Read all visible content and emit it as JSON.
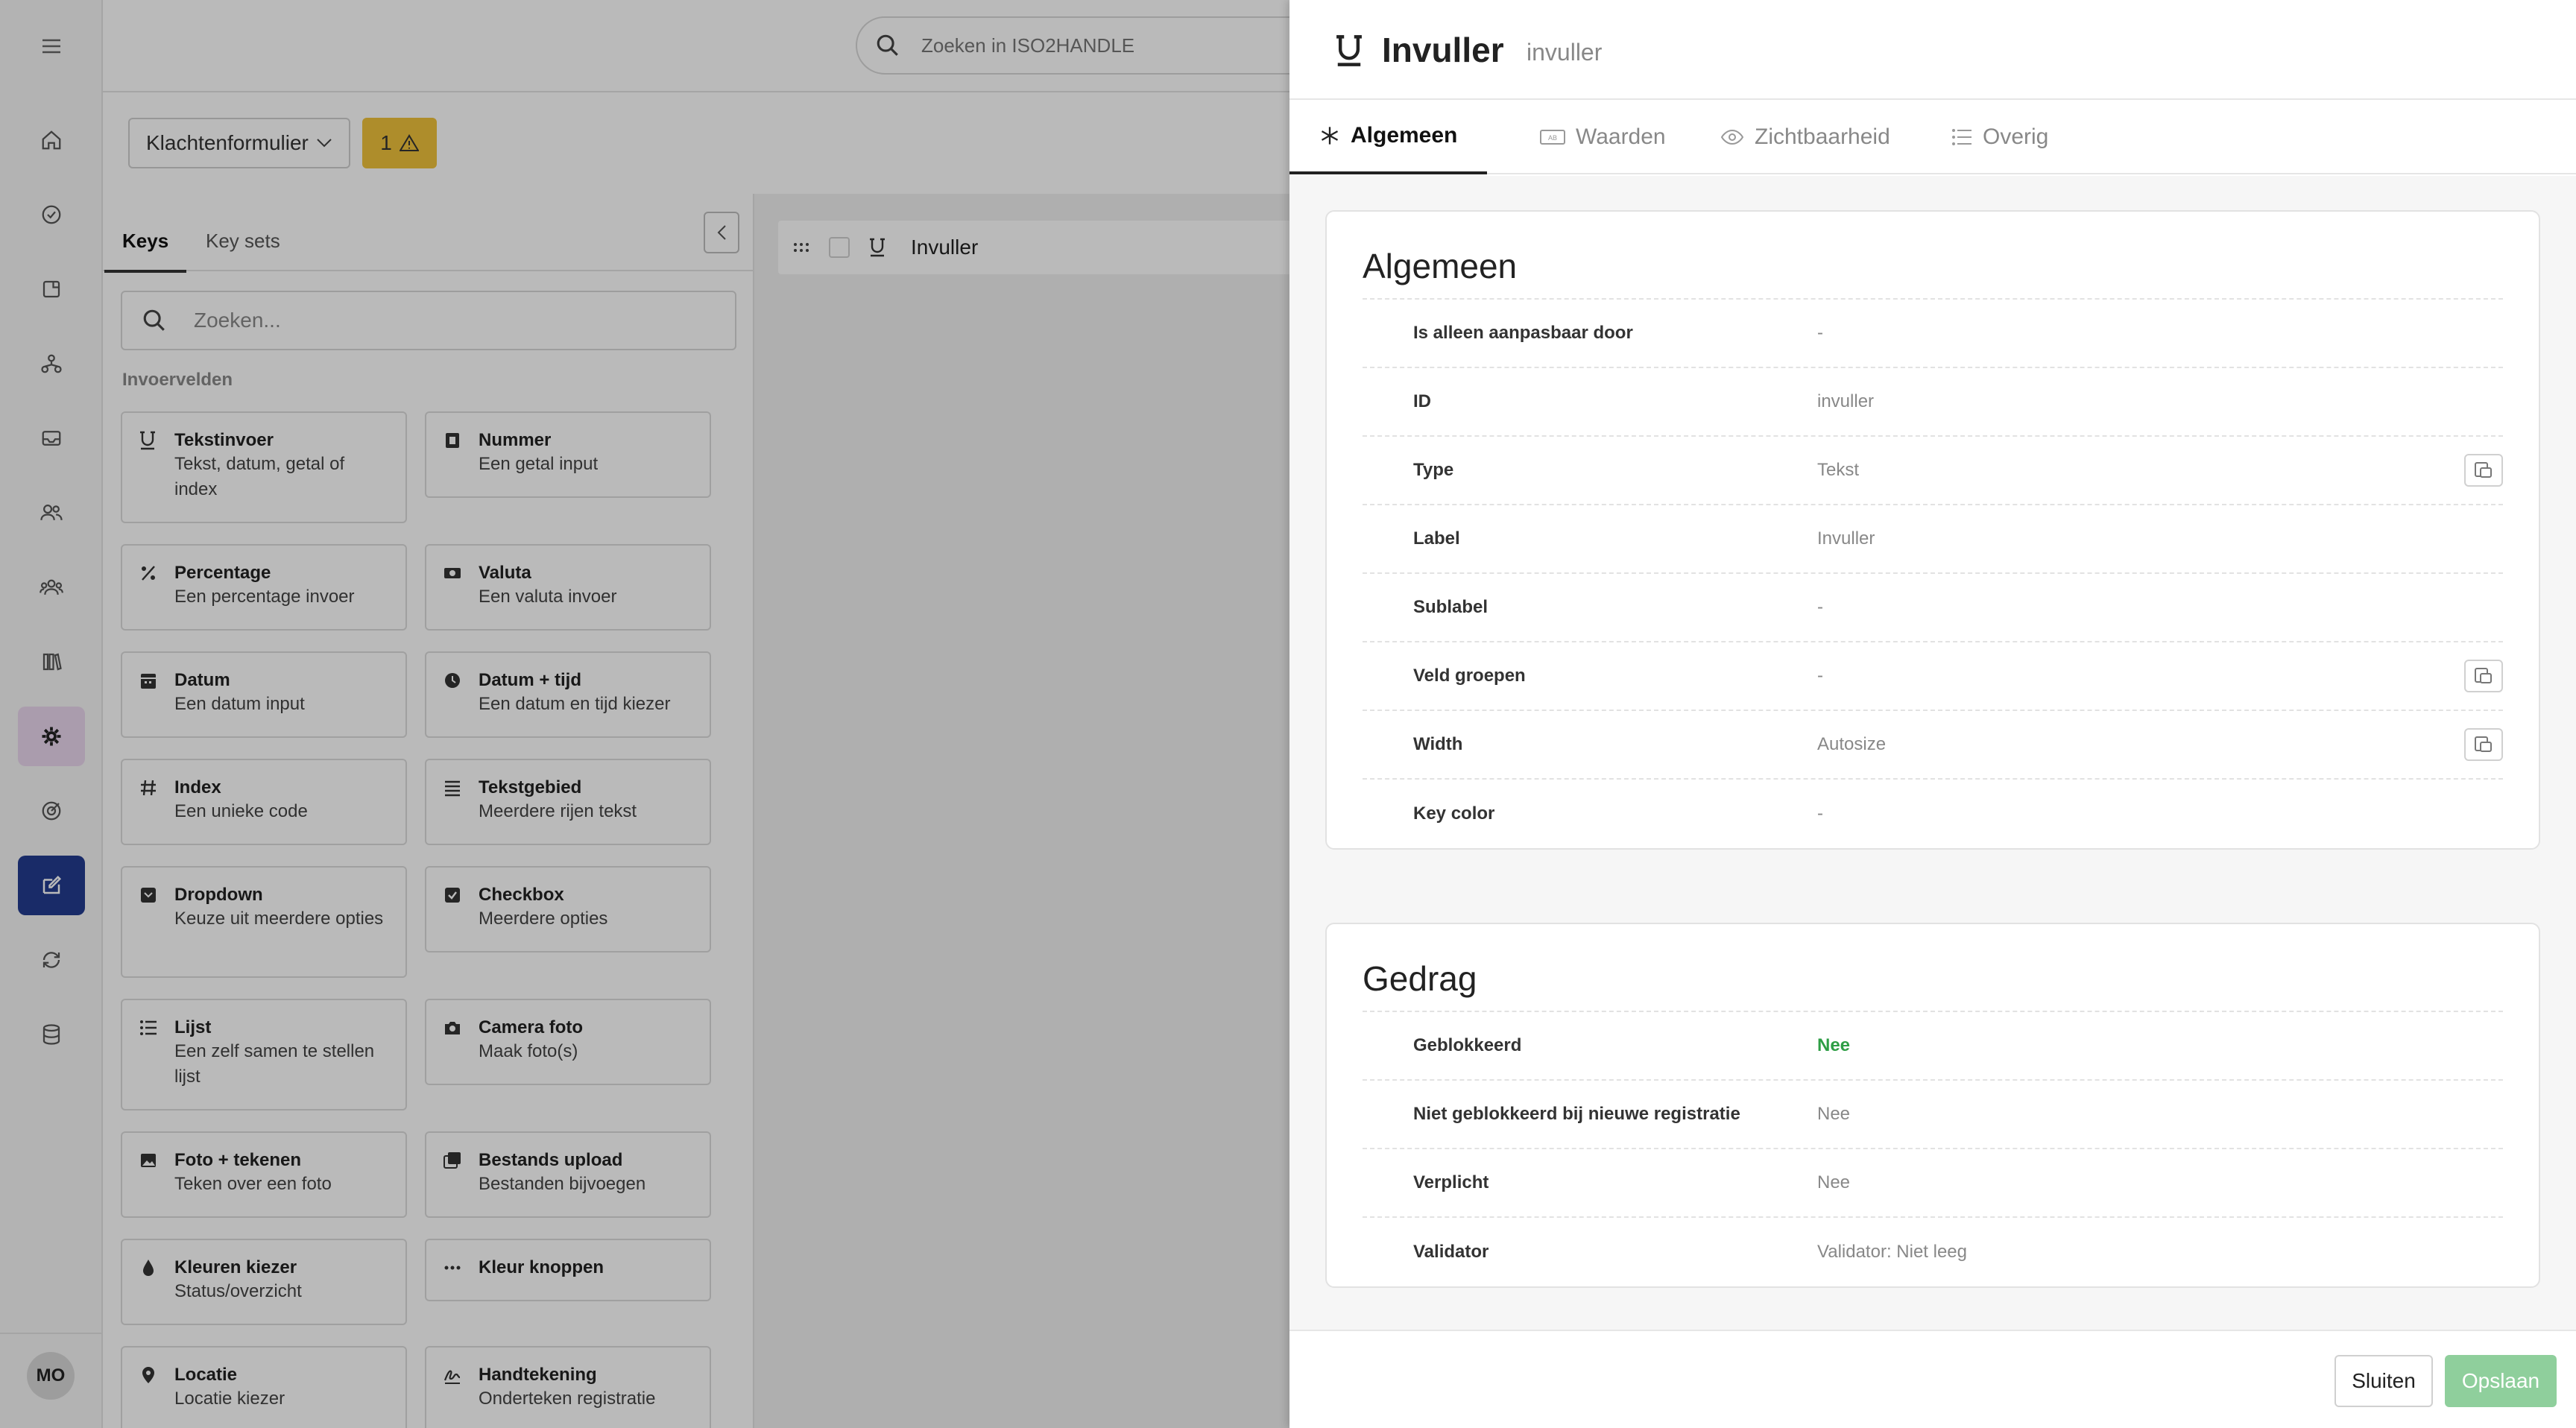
{
  "topbar": {
    "search_placeholder": "Zoeken in ISO2HANDLE"
  },
  "rail": {
    "items": [
      "home-icon",
      "check-circle-icon",
      "folder-icon",
      "hierarchy-icon",
      "inbox-icon",
      "users-icon",
      "group-icon",
      "books-icon",
      "gear-icon",
      "target-icon",
      "edit-form-icon",
      "sync-icon",
      "database-icon"
    ],
    "avatar_initials": "MO"
  },
  "form_selector": {
    "value": "Klachtenformulier",
    "warning_count": "1"
  },
  "keys_panel": {
    "tabs": [
      {
        "label": "Keys"
      },
      {
        "label": "Key sets"
      }
    ],
    "search_placeholder": "Zoeken...",
    "section_label": "Invoervelden",
    "cards": [
      {
        "title": "Tekstinvoer",
        "desc": "Tekst, datum, getal of index",
        "icon": "text-input-icon"
      },
      {
        "title": "Nummer",
        "desc": "Een getal input",
        "icon": "number-icon"
      },
      {
        "title": "Percentage",
        "desc": "Een percentage invoer",
        "icon": "percent-icon"
      },
      {
        "title": "Valuta",
        "desc": "Een valuta invoer",
        "icon": "currency-icon"
      },
      {
        "title": "Datum",
        "desc": "Een datum input",
        "icon": "calendar-icon"
      },
      {
        "title": "Datum + tijd",
        "desc": "Een datum en tijd kiezer",
        "icon": "clock-icon"
      },
      {
        "title": "Index",
        "desc": "Een unieke code",
        "icon": "hash-icon"
      },
      {
        "title": "Tekstgebied",
        "desc": "Meerdere rijen tekst",
        "icon": "lines-icon"
      },
      {
        "title": "Dropdown",
        "desc": "Keuze uit meerdere opties",
        "icon": "dropdown-icon"
      },
      {
        "title": "Checkbox",
        "desc": "Meerdere opties",
        "icon": "checkbox-icon"
      },
      {
        "title": "Lijst",
        "desc": "Een zelf samen te stellen lijst",
        "icon": "list-icon"
      },
      {
        "title": "Camera foto",
        "desc": "Maak foto(s)",
        "icon": "camera-icon"
      },
      {
        "title": "Foto + tekenen",
        "desc": "Teken over een foto",
        "icon": "image-icon"
      },
      {
        "title": "Bestands upload",
        "desc": "Bestanden bijvoegen",
        "icon": "upload-icon"
      },
      {
        "title": "Kleuren kiezer",
        "desc": "Status/overzicht",
        "icon": "droplet-icon"
      },
      {
        "title": "Kleur knoppen",
        "desc": "",
        "icon": "dots-icon"
      },
      {
        "title": "Locatie",
        "desc": "Locatie kiezer",
        "icon": "location-icon"
      },
      {
        "title": "Handtekening",
        "desc": "Onderteken registratie",
        "icon": "signature-icon"
      }
    ]
  },
  "canvas": {
    "row_label": "Invuller"
  },
  "drawer": {
    "title": "Invuller",
    "subtitle": "invuller",
    "tabs": [
      {
        "label": "Algemeen",
        "icon": "asterisk-icon"
      },
      {
        "label": "Waarden",
        "icon": "ab-icon"
      },
      {
        "label": "Zichtbaarheid",
        "icon": "eye-icon"
      },
      {
        "label": "Overig",
        "icon": "list-icon"
      }
    ],
    "general": {
      "title": "Algemeen",
      "rows": [
        {
          "label": "Is alleen aanpasbaar door",
          "value": "-"
        },
        {
          "label": "ID",
          "value": "invuller"
        },
        {
          "label": "Type",
          "value": "Tekst"
        },
        {
          "label": "Label",
          "value": "Invuller"
        },
        {
          "label": "Sublabel",
          "value": "-"
        },
        {
          "label": "Veld groepen",
          "value": "-"
        },
        {
          "label": "Width",
          "value": "Autosize"
        },
        {
          "label": "Key color",
          "value": "-"
        }
      ]
    },
    "behaviour": {
      "title": "Gedrag",
      "rows": [
        {
          "label": "Geblokkeerd",
          "value": "Nee"
        },
        {
          "label": "Niet geblokkeerd bij nieuwe registratie",
          "value": "Nee"
        },
        {
          "label": "Verplicht",
          "value": "Nee"
        },
        {
          "label": "Validator",
          "value": "Validator: Niet leeg"
        }
      ]
    },
    "footer": {
      "close_label": "Sluiten",
      "save_label": "Opslaan"
    },
    "colors": {
      "success": "#2e9e45",
      "save_button": "#8fcf9c",
      "active_nav": "#233c8f",
      "warning": "#efc23b"
    }
  }
}
